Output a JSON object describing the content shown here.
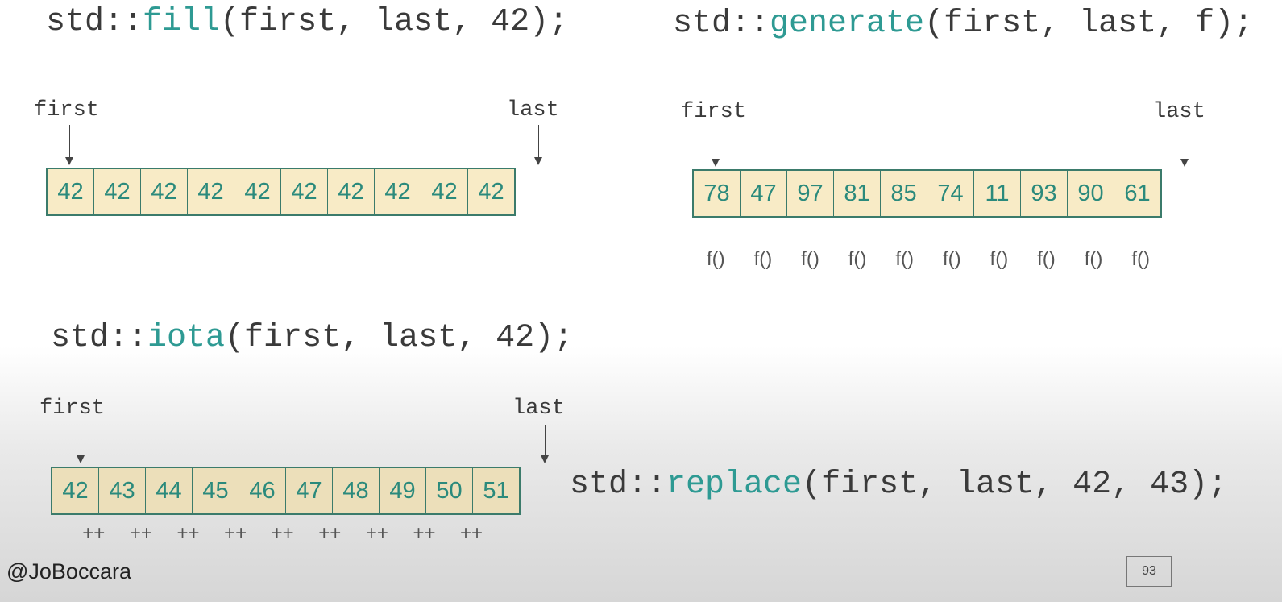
{
  "accent_color": "#2e9a93",
  "cell_fill": "#f8ebc6",
  "fill": {
    "prefix": "std::",
    "fn": "fill",
    "args": "(first, last, 42);",
    "first": "first",
    "last": "last",
    "values": [
      "42",
      "42",
      "42",
      "42",
      "42",
      "42",
      "42",
      "42",
      "42",
      "42"
    ]
  },
  "generate": {
    "prefix": "std::",
    "fn": "generate",
    "args": "(first, last, f);",
    "first": "first",
    "last": "last",
    "values": [
      "78",
      "47",
      "97",
      "81",
      "85",
      "74",
      "11",
      "93",
      "90",
      "61"
    ],
    "calls": [
      "f()",
      "f()",
      "f()",
      "f()",
      "f()",
      "f()",
      "f()",
      "f()",
      "f()",
      "f()"
    ]
  },
  "iota": {
    "prefix": "std::",
    "fn": "iota",
    "args": "(first, last, 42);",
    "first": "first",
    "last": "last",
    "values": [
      "42",
      "43",
      "44",
      "45",
      "46",
      "47",
      "48",
      "49",
      "50",
      "51"
    ],
    "increments": [
      "++",
      "++",
      "++",
      "++",
      "++",
      "++",
      "++",
      "++",
      "++"
    ]
  },
  "replace": {
    "prefix": "std::",
    "fn": "replace",
    "args": "(first, last, 42, 43);"
  },
  "footer": {
    "handle": "@JoBoccara",
    "page": "93"
  }
}
